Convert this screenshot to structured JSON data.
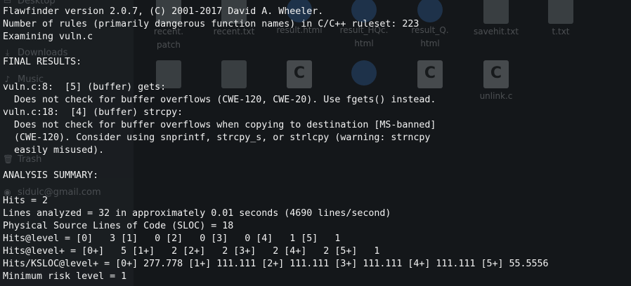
{
  "terminal": {
    "lines": [
      "Flawfinder version 2.0.7, (C) 2001-2017 David A. Wheeler.",
      "Number of rules (primarily dangerous function names) in C/C++ ruleset: 223",
      "Examining vuln.c",
      "",
      "FINAL RESULTS:",
      "",
      "vuln.c:8:  [5] (buffer) gets:",
      "  Does not check for buffer overflows (CWE-120, CWE-20). Use fgets() instead.",
      "vuln.c:18:  [4] (buffer) strcpy:",
      "  Does not check for buffer overflows when copying to destination [MS-banned]",
      "  (CWE-120). Consider using snprintf, strcpy_s, or strlcpy (warning: strncpy",
      "  easily misused).",
      "",
      "ANALYSIS SUMMARY:",
      "",
      "Hits = 2",
      "Lines analyzed = 32 in approximately 0.01 seconds (4690 lines/second)",
      "Physical Source Lines of Code (SLOC) = 18",
      "Hits@level = [0]   3 [1]   0 [2]   0 [3]   0 [4]   1 [5]   1",
      "Hits@level+ = [0+]   5 [1+]   2 [2+]   2 [3+]   2 [4+]   2 [5+]   1",
      "Hits/KSLOC@level+ = [0+] 277.778 [1+] 111.111 [2+] 111.111 [3+] 111.111 [4+] 111.111 [5+] 55.5556",
      "Minimum risk level = 1"
    ]
  },
  "background_file_manager": {
    "sidebar_items": [
      {
        "label": "Desktop",
        "icon": "folder-icon"
      },
      {
        "label": "Downloads",
        "icon": "download-icon"
      },
      {
        "label": "Music",
        "icon": "music-icon"
      },
      {
        "label": "Trash",
        "icon": "trash-icon"
      },
      {
        "label": "sidulc@gmail.com",
        "icon": "account-icon"
      }
    ],
    "files_row1": [
      {
        "label1": "recent.",
        "label2": "patch",
        "icon": "doc"
      },
      {
        "label1": "recent.txt",
        "label2": "",
        "icon": "doc"
      },
      {
        "label1": "result.html",
        "label2": "",
        "icon": "html"
      },
      {
        "label1": "result_HQc.",
        "label2": "html",
        "icon": "html"
      },
      {
        "label1": "result_Q.",
        "label2": "html",
        "icon": "html"
      },
      {
        "label1": "savehit.txt",
        "label2": "",
        "icon": "doc"
      },
      {
        "label1": "t.txt",
        "label2": "",
        "icon": "doc"
      }
    ],
    "files_row2": [
      {
        "label1": "",
        "icon": "doc"
      },
      {
        "label1": "",
        "icon": "doc"
      },
      {
        "label1": "",
        "icon": "c-src",
        "letter": "C"
      },
      {
        "label1": "",
        "icon": "html"
      },
      {
        "label1": "",
        "icon": "c-src",
        "letter": "C"
      },
      {
        "label1": "unlink.c",
        "icon": "c-src",
        "letter": "C"
      }
    ]
  },
  "colors": {
    "terminal_bg": "#14171a",
    "terminal_fg": "#f2f2f2",
    "sidebar_bg": "#2b3035"
  }
}
